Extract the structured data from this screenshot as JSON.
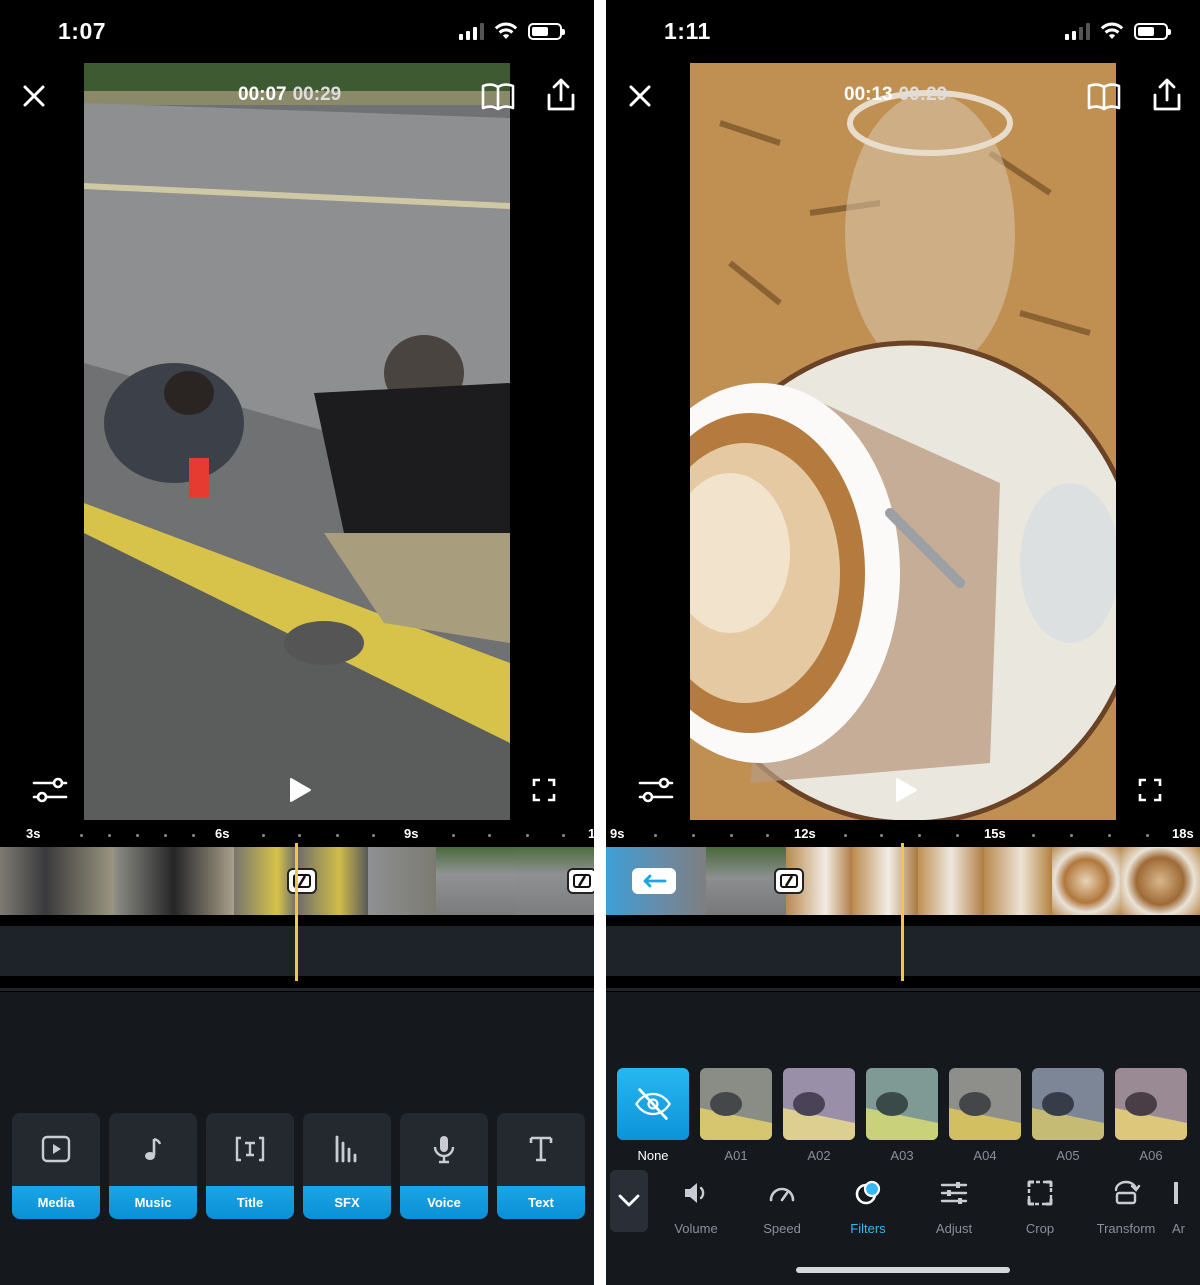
{
  "left": {
    "status_time": "1:07",
    "current_time": "00:07",
    "total_time": "00:29",
    "ruler_labels": [
      "3s",
      "6s",
      "9s",
      "1"
    ],
    "tools": [
      {
        "label": "Media",
        "icon": "media-icon"
      },
      {
        "label": "Music",
        "icon": "music-icon"
      },
      {
        "label": "Title",
        "icon": "title-icon"
      },
      {
        "label": "SFX",
        "icon": "sfx-icon"
      },
      {
        "label": "Voice",
        "icon": "microphone-icon"
      },
      {
        "label": "Text",
        "icon": "text-icon"
      }
    ]
  },
  "right": {
    "status_time": "1:11",
    "current_time": "00:13",
    "total_time": "00:29",
    "ruler_labels": [
      "9s",
      "12s",
      "15s",
      "18s"
    ],
    "filters": [
      {
        "label": "None"
      },
      {
        "label": "A01"
      },
      {
        "label": "A02"
      },
      {
        "label": "A03"
      },
      {
        "label": "A04"
      },
      {
        "label": "A05"
      },
      {
        "label": "A06"
      }
    ],
    "clip_tools": [
      {
        "label": "Volume",
        "icon": "speaker-icon"
      },
      {
        "label": "Speed",
        "icon": "speedometer-icon"
      },
      {
        "label": "Filters",
        "icon": "filters-icon"
      },
      {
        "label": "Adjust",
        "icon": "sliders-icon"
      },
      {
        "label": "Crop",
        "icon": "crop-icon"
      },
      {
        "label": "Transform",
        "icon": "transform-icon"
      },
      {
        "label": "Ar",
        "icon": ""
      }
    ]
  },
  "colors": {
    "accent": "#1aa6e6",
    "playhead": "#f2c744",
    "active_tool": "#38b6f5"
  }
}
